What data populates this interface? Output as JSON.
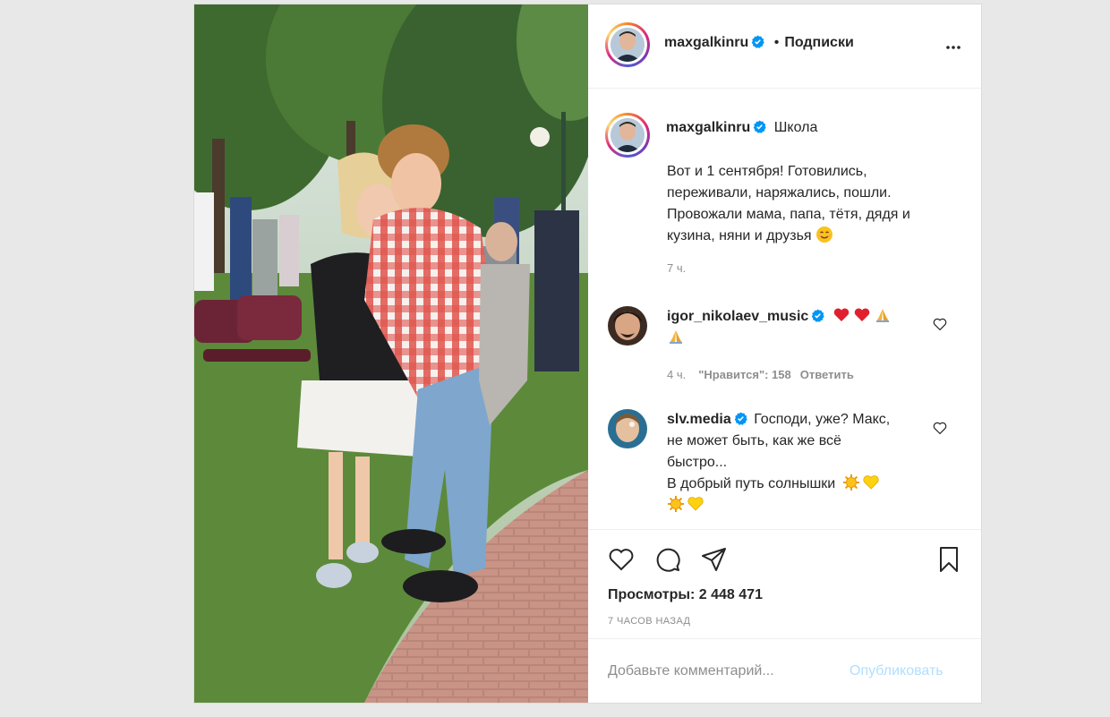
{
  "colors": {
    "accent": "#0095f6",
    "publish_disabled": "#b2dffc",
    "heart_red": "#ed4956",
    "muted": "#8e8e8e"
  },
  "header": {
    "username": "maxgalkinru",
    "separator": "•",
    "follow_label": "Подписки",
    "more_icon": "more-horizontal-icon"
  },
  "caption": {
    "username": "maxgalkinru",
    "location": "Школа",
    "text": "Вот и 1 сентября! Готовились, переживали, наряжались, пошли. Провожали мама, папа, тётя, дядя и кузина, няни и друзья",
    "emoji": "smiling-face-icon",
    "time": "7 ч."
  },
  "comments": [
    {
      "username": "igor_nikolaev_music",
      "emojis": [
        "red-heart-icon",
        "red-heart-icon",
        "folded-hands-icon",
        "folded-hands-icon"
      ],
      "time": "4 ч.",
      "likes": "\"Нравится\": 158",
      "reply": "Ответить"
    },
    {
      "username": "slv.media",
      "text_line1": "Господи, уже? Макс,",
      "text_line2": "не может быть, как же всё",
      "text_line3": "быстро...",
      "text_line4": "В добрый путь солнышки",
      "emojis": [
        "sun-icon",
        "yellow-heart-icon",
        "sun-icon",
        "yellow-heart-icon"
      ]
    }
  ],
  "actions": {
    "views_label": "Просмотры: 2 448 471",
    "time_ago": "7 часов назад",
    "icons": [
      "heart-icon",
      "comment-icon",
      "share-icon",
      "bookmark-icon"
    ]
  },
  "add_comment": {
    "placeholder": "Добавьте комментарий...",
    "publish_label": "Опубликовать"
  }
}
